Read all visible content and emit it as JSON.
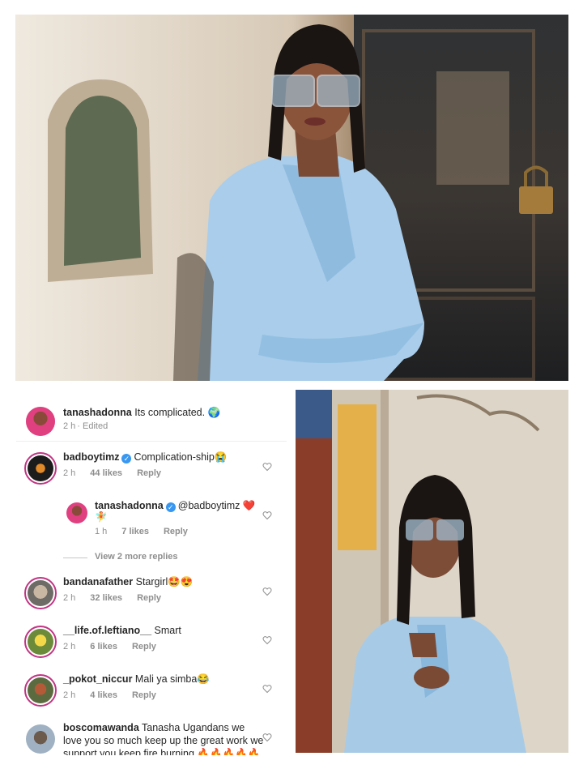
{
  "caption": {
    "username": "tanashadonna",
    "text": "Its complicated. 🌍",
    "time": "2 h",
    "edited": "Edited"
  },
  "comments": [
    {
      "username": "badboytimz",
      "verified": true,
      "text": "Complication-ship😭",
      "time": "2 h",
      "likes": "44 likes",
      "reply": "Reply"
    },
    {
      "username": "tanashadonna",
      "verified": true,
      "text": "@badboytimz ❤️",
      "text_line2": "🧚",
      "time": "1 h",
      "likes": "7 likes",
      "reply": "Reply"
    },
    {
      "username": "bandanafather",
      "text": "Stargirl🤩😍",
      "time": "2 h",
      "likes": "32 likes",
      "reply": "Reply"
    },
    {
      "username": "__life.of.leftiano__",
      "text": "Smart",
      "time": "2 h",
      "likes": "6 likes",
      "reply": "Reply"
    },
    {
      "username": "_pokot_niccur",
      "text": "Mali ya simba😂",
      "time": "2 h",
      "likes": "4 likes",
      "reply": "Reply"
    },
    {
      "username": "boscomawanda",
      "text": "Tanasha Ugandans we",
      "text_line2": "love you so much keep up the great work we",
      "text_line3": "support you keep fire burning 🔥🔥🔥🔥🔥"
    }
  ],
  "view_replies": "View 2 more replies",
  "colors": {
    "verified": "#3897f0",
    "story_ring": "#c13584",
    "meta": "#8e8e8e"
  }
}
